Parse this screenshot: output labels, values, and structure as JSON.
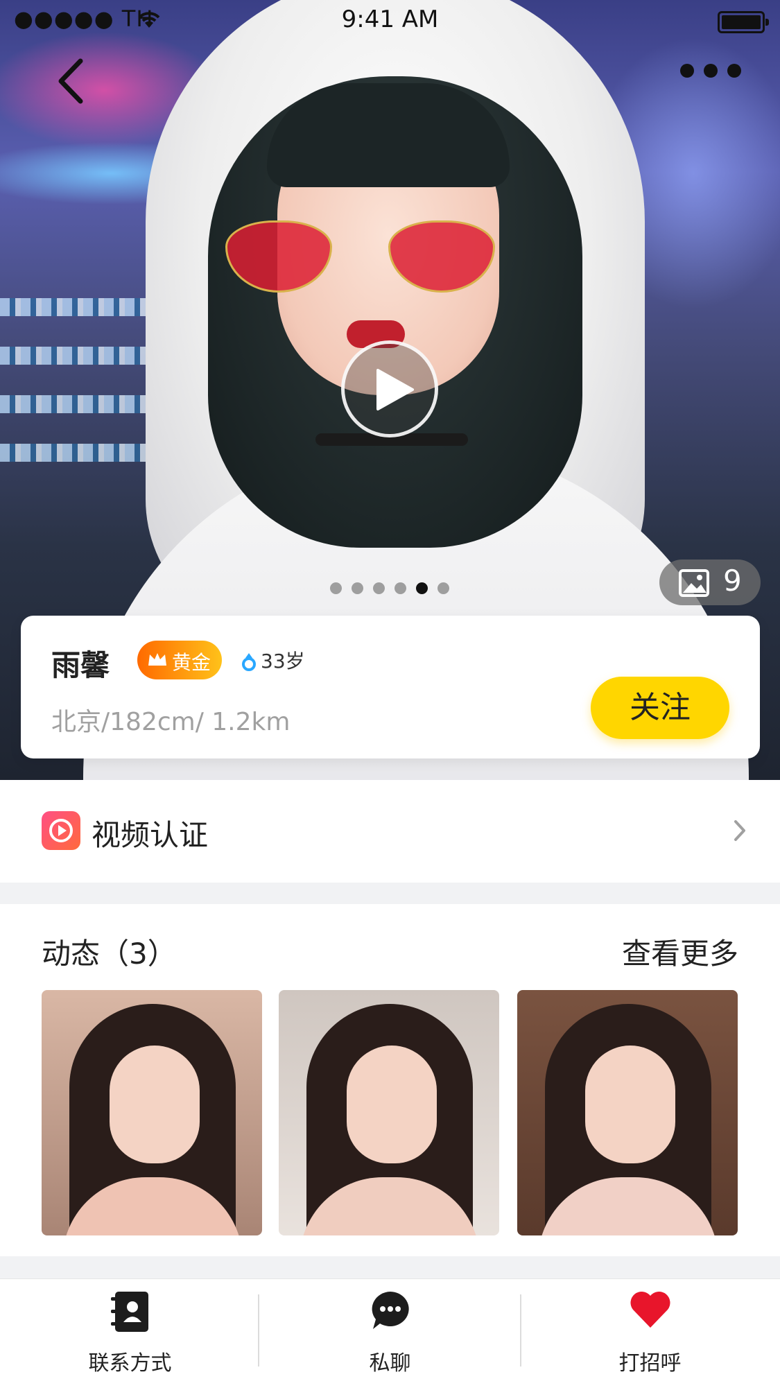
{
  "status_bar": {
    "carrier": "●●●●● TH",
    "time": "9:41 AM"
  },
  "profile": {
    "name": "雨馨",
    "vip_label": "黄金",
    "age": "33岁",
    "meta": "北京/182cm/ 1.2km",
    "follow_label": "关注",
    "photo_count": "9",
    "carousel": {
      "total": 6,
      "active_index": 4
    }
  },
  "verify": {
    "label": "视频认证"
  },
  "moments": {
    "title": "动态（3）",
    "more_label": "查看更多"
  },
  "tabbar": {
    "items": [
      {
        "label": "联系方式",
        "icon": "contact-book-icon"
      },
      {
        "label": "私聊",
        "icon": "chat-bubble-icon"
      },
      {
        "label": "打招呼",
        "icon": "heart-icon"
      }
    ]
  },
  "colors": {
    "accent_yellow": "#ffd600",
    "vip_start": "#ff6a00",
    "vip_end": "#ffc21a",
    "heart_red": "#e8152b",
    "verify_pink": "#ff4f84"
  }
}
